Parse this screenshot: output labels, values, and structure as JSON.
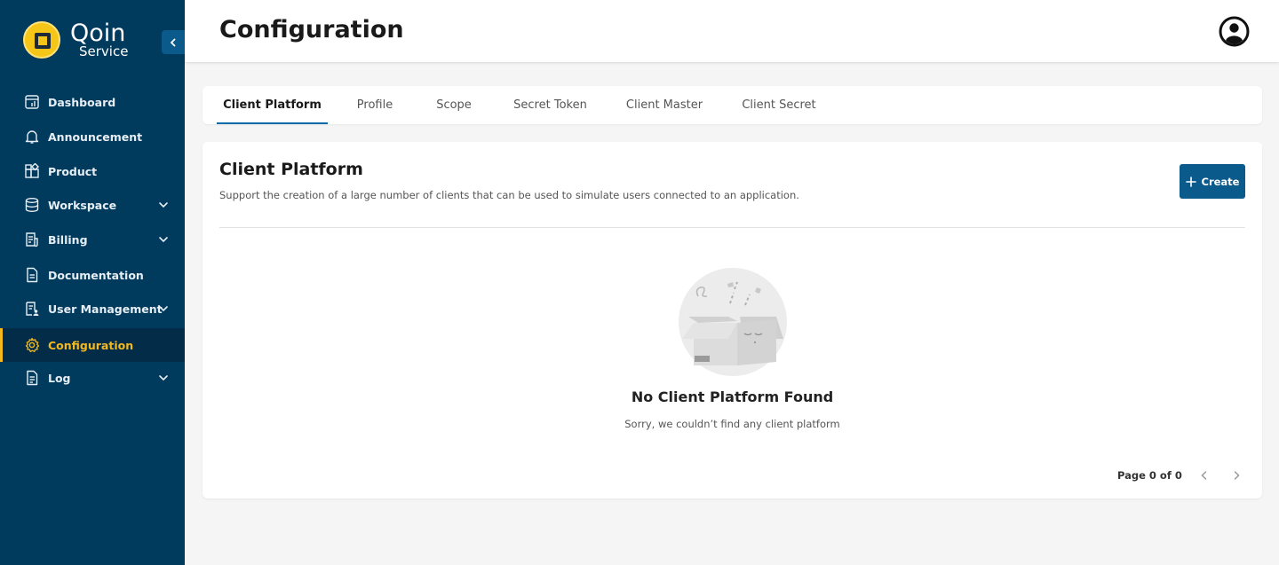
{
  "brand": {
    "name_line1": "Qoin",
    "name_line2": "Service",
    "logo_color": "#f5c518"
  },
  "sidebar": {
    "bg_color": "#003a5d",
    "active_color": "#f5b81c",
    "items": [
      {
        "label": "Dashboard",
        "icon": "dashboard-icon",
        "expandable": false,
        "active": false
      },
      {
        "label": "Announcement",
        "icon": "bell-icon",
        "expandable": false,
        "active": false
      },
      {
        "label": "Product",
        "icon": "product-icon",
        "expandable": false,
        "active": false
      },
      {
        "label": "Workspace",
        "icon": "database-icon",
        "expandable": true,
        "active": false
      },
      {
        "label": "Billing",
        "icon": "billing-icon",
        "expandable": true,
        "active": false
      },
      {
        "label": "Documentation",
        "icon": "document-icon",
        "expandable": false,
        "active": false
      },
      {
        "label": "User Management",
        "icon": "user-management-icon",
        "expandable": true,
        "active": false
      },
      {
        "label": "Configuration",
        "icon": "gear-icon",
        "expandable": false,
        "active": true
      },
      {
        "label": "Log",
        "icon": "log-icon",
        "expandable": true,
        "active": false
      }
    ]
  },
  "header": {
    "title": "Configuration"
  },
  "tabs": [
    {
      "label": "Client Platform",
      "active": true
    },
    {
      "label": "Profile",
      "active": false
    },
    {
      "label": "Scope",
      "active": false
    },
    {
      "label": "Secret Token",
      "active": false
    },
    {
      "label": "Client Master",
      "active": false
    },
    {
      "label": "Client Secret",
      "active": false
    }
  ],
  "section": {
    "title": "Client Platform",
    "description": "Support the creation of a large number of clients that can be used to simulate users connected to an application.",
    "create_label": "Create",
    "accent_color": "#0b5a8c"
  },
  "empty_state": {
    "title": "No Client Platform Found",
    "subtitle": "Sorry, we couldn’t find any client platform"
  },
  "pagination": {
    "label": "Page 0 of 0"
  }
}
